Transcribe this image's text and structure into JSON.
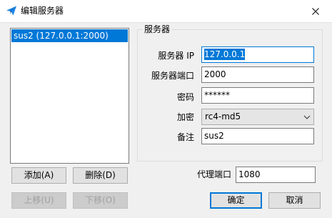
{
  "window": {
    "title": "编辑服务器",
    "app_icon": "paper-plane-icon",
    "close_icon": "close-icon"
  },
  "server_list": {
    "items": [
      "sus2 (127.0.0.1:2000)"
    ],
    "selected_index": 0
  },
  "buttons": {
    "add": "添加(A)",
    "delete": "删除(D)",
    "move_up": "上移(U)",
    "move_down": "下移(O)",
    "ok": "确定",
    "cancel": "取消"
  },
  "server_group": {
    "title": "服务器",
    "ip_label": "服务器 IP",
    "ip_value": "127.0.0.1",
    "port_label": "服务器端口",
    "port_value": "2000",
    "password_label": "密码",
    "password_value": "******",
    "encryption_label": "加密",
    "encryption_value": "rc4-md5",
    "remarks_label": "备注",
    "remarks_value": "sus2"
  },
  "proxy": {
    "label": "代理端口",
    "value": "1080"
  },
  "colors": {
    "selection": "#0078d7",
    "face": "#f0f0f0",
    "title_bar": "#ffffff",
    "icon": "#1e88e5"
  }
}
